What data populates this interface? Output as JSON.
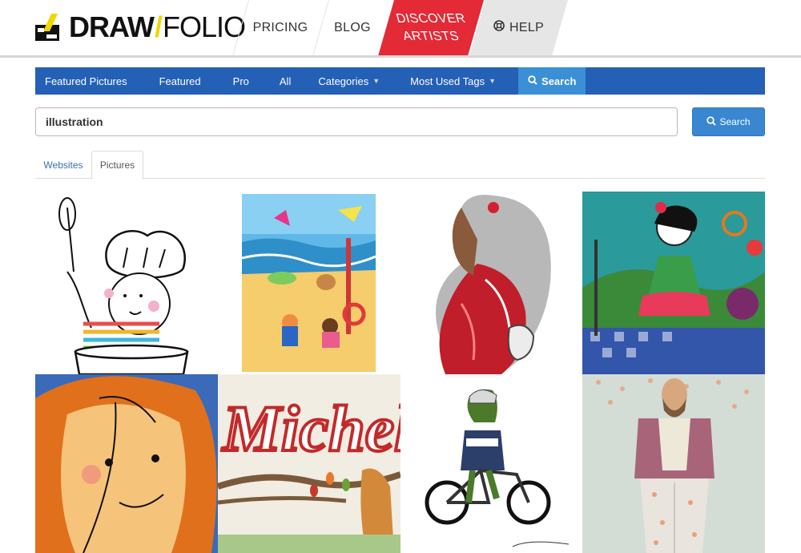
{
  "brand": {
    "logo_text_bold": "DRAW",
    "logo_slash": "/",
    "logo_text_thin": "FOLIO"
  },
  "top_nav": {
    "pricing": "PRICING",
    "blog": "BLOG",
    "discover_line1": "DISCOVER",
    "discover_line2": "ARTISTS",
    "help": "HELP"
  },
  "blue_nav": {
    "featured_pictures": "Featured Pictures",
    "featured": "Featured",
    "pro": "Pro",
    "all": "All",
    "categories": "Categories",
    "most_used_tags": "Most Used Tags",
    "search": "Search"
  },
  "search": {
    "value": "illustration",
    "button_label": "Search"
  },
  "tabs": {
    "websites": "Websites",
    "pictures": "Pictures",
    "active": "Pictures"
  },
  "gallery": [
    {
      "subject": "chef child with whisk",
      "icon": "chef-illustration"
    },
    {
      "subject": "beach scene with kites",
      "icon": "beach-illustration"
    },
    {
      "subject": "woman with long red and white hair",
      "icon": "hair-portrait-illustration"
    },
    {
      "subject": "flamenco girl with tambourine",
      "icon": "flamenco-illustration"
    },
    {
      "subject": "orange-haired face closeup",
      "icon": "face-closeup-illustration"
    },
    {
      "subject": "lettering on striped letters",
      "icon": "lettering-illustration",
      "text": "Michelle"
    },
    {
      "subject": "wolf on bicycle",
      "icon": "wolf-bike-illustration"
    },
    {
      "subject": "bearded man in floral pants",
      "icon": "fashion-man-illustration"
    }
  ],
  "colors": {
    "blue_nav": "#2460b6",
    "search_highlight": "#3b8fd6",
    "discover_red": "#e32a36",
    "help_grey": "#e6e6e6",
    "logo_yellow": "#f2d600"
  }
}
